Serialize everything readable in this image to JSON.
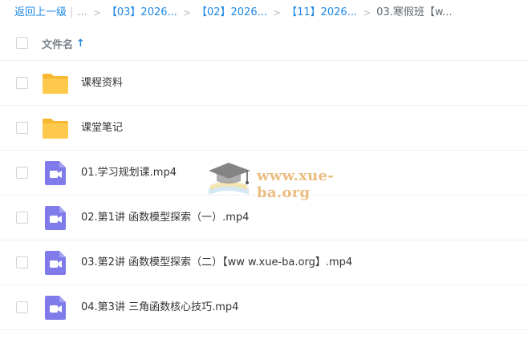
{
  "breadcrumb": {
    "back": "返回上一级",
    "ellipsis": "...",
    "items": [
      "【03】2026...",
      "【02】2026...",
      "【11】2026..."
    ],
    "current": "03.寒假班【w..."
  },
  "list": {
    "header_label": "文件名",
    "sort_indicator": "↑",
    "rows": [
      {
        "type": "folder",
        "name": "课程资料"
      },
      {
        "type": "folder",
        "name": "课堂笔记"
      },
      {
        "type": "video",
        "name": "01.学习规划课.mp4"
      },
      {
        "type": "video",
        "name": "02.第1讲 函数模型探索（一）.mp4"
      },
      {
        "type": "video",
        "name": "03.第2讲 函数模型探索（二）【ww w.xue-ba.org】.mp4"
      },
      {
        "type": "video",
        "name": "04.第3讲 三角函数核心技巧.mp4"
      }
    ]
  },
  "watermark": {
    "text": "www.xue-ba.org"
  },
  "colors": {
    "accent": "#1e88e5",
    "folder": "#ffc94d",
    "video": "#7f7bea"
  }
}
